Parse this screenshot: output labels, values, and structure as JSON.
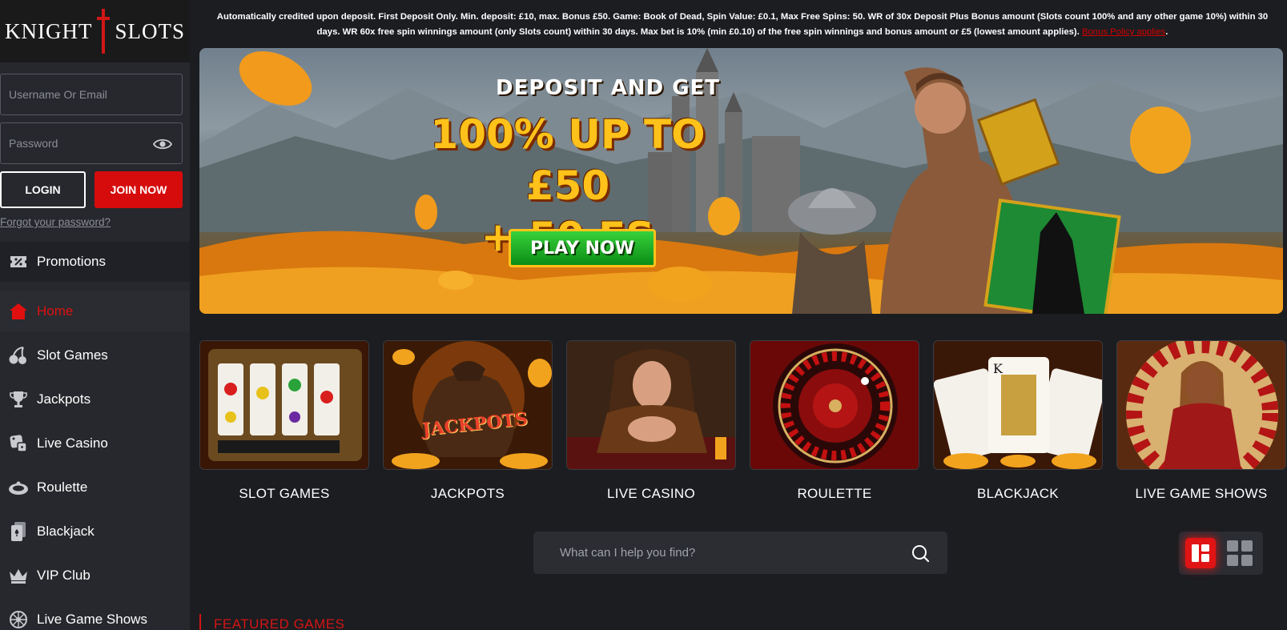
{
  "brand": {
    "name_left": "KNIGHT",
    "name_right": "SLOTS",
    "accent": "#d60c0c"
  },
  "auth": {
    "username_placeholder": "Username Or Email",
    "password_placeholder": "Password",
    "login_label": "LOGIN",
    "join_label": "JOIN NOW",
    "forgot_label": "Forgot your password?"
  },
  "nav": {
    "promotions": "Promotions",
    "items": [
      {
        "label": "Home",
        "icon": "home-icon",
        "active": true
      },
      {
        "label": "Slot Games",
        "icon": "cherries-icon"
      },
      {
        "label": "Jackpots",
        "icon": "trophy-icon"
      },
      {
        "label": "Live Casino",
        "icon": "dice-icon"
      },
      {
        "label": "Roulette",
        "icon": "roulette-icon"
      },
      {
        "label": "Blackjack",
        "icon": "cards-icon"
      },
      {
        "label": "VIP Club",
        "icon": "crown-icon"
      },
      {
        "label": "Live Game Shows",
        "icon": "wheel-icon"
      }
    ]
  },
  "terms": {
    "text": "Automatically credited upon deposit. First Deposit Only. Min. deposit: £10, max. Bonus £50. Game: Book of Dead, Spin Value: £0.1, Max Free Spins: 50. WR of 30x Deposit Plus Bonus amount (Slots count 100% and any other game 10%) within 30 days. WR 60x free spin winnings amount (only Slots count) within 30 days. Max bet is 10% (min £0.10) of the free spin winnings and bonus amount or £5 (lowest amount applies).",
    "link": "Bonus Policy applies"
  },
  "banner": {
    "kicker": "DEPOSIT AND GET",
    "line1": "100% UP TO £50",
    "line2": "+ 50 FS",
    "cta": "PLAY NOW"
  },
  "categories": [
    {
      "label": "SLOT GAMES"
    },
    {
      "label": "JACKPOTS"
    },
    {
      "label": "LIVE CASINO"
    },
    {
      "label": "ROULETTE"
    },
    {
      "label": "BLACKJACK"
    },
    {
      "label": "LIVE GAME SHOWS"
    }
  ],
  "jackpots_bag_text": "JACKPOTS",
  "search": {
    "placeholder": "What can I help you find?"
  },
  "featured": {
    "title": "FEATURED GAMES"
  }
}
